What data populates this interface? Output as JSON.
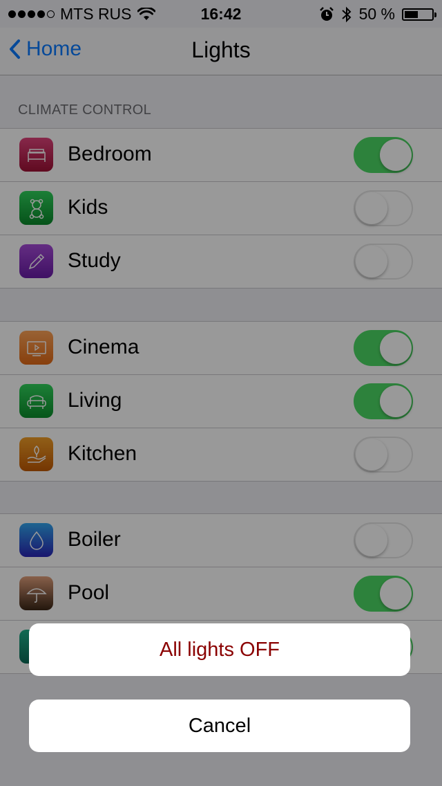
{
  "status_bar": {
    "carrier": "MTS RUS",
    "time": "16:42",
    "battery_percent_label": "50 %",
    "battery_level": 0.5
  },
  "nav": {
    "back_label": "Home",
    "title": "Lights"
  },
  "section_header": "CLIMATE CONTROL",
  "groups": [
    {
      "rows": [
        {
          "label": "Bedroom",
          "icon": "bed-icon",
          "color_top": "#e0437c",
          "color_bottom": "#a01236",
          "on": true
        },
        {
          "label": "Kids",
          "icon": "teddy-bear-icon",
          "color_top": "#2fd35c",
          "color_bottom": "#0b8a2c",
          "on": false
        },
        {
          "label": "Study",
          "icon": "pencil-icon",
          "color_top": "#a64bd9",
          "color_bottom": "#6a1ca8",
          "on": false
        }
      ]
    },
    {
      "rows": [
        {
          "label": "Cinema",
          "icon": "tv-icon",
          "color_top": "#ffa458",
          "color_bottom": "#e26a17",
          "on": true
        },
        {
          "label": "Living",
          "icon": "armchair-icon",
          "color_top": "#31d45d",
          "color_bottom": "#0b8f2c",
          "on": true
        },
        {
          "label": "Kitchen",
          "icon": "hand-plant-icon",
          "color_top": "#f29f28",
          "color_bottom": "#c25a04",
          "on": false
        }
      ]
    },
    {
      "rows": [
        {
          "label": "Boiler",
          "icon": "water-drop-icon",
          "color_top": "#32a7f0",
          "color_bottom": "#2a25b8",
          "on": false
        },
        {
          "label": "Pool",
          "icon": "umbrella-icon",
          "color_top": "#e3a07c",
          "color_bottom": "#3a2616",
          "on": true
        },
        {
          "label": "",
          "icon": "plant-icon",
          "color_top": "#1fb08a",
          "color_bottom": "#0a6b57",
          "on": true
        }
      ]
    }
  ],
  "action_sheet": {
    "destructive_label": "All lights OFF",
    "cancel_label": "Cancel"
  }
}
